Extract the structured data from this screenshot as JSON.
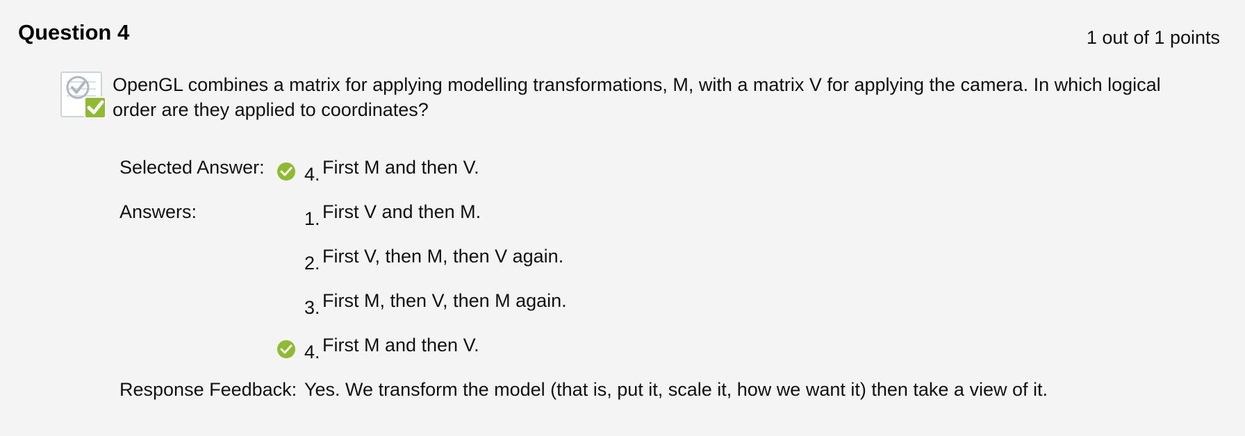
{
  "question": {
    "title": "Question 4",
    "points": "1 out of 1 points",
    "text": "OpenGL combines a matrix for applying modelling transformations, M, with a matrix V for applying the camera. In which logical order are they applied to coordinates?",
    "status_icon": "correct-question-icon"
  },
  "labels": {
    "selected_answer": "Selected Answer:",
    "answers": "Answers:",
    "response_feedback": "Response Feedback:"
  },
  "selected_answer": {
    "number": "4.",
    "text": "First M and then V.",
    "correct": true
  },
  "answers": [
    {
      "number": "1.",
      "text": "First V and then M.",
      "correct": false
    },
    {
      "number": "2.",
      "text": "First V, then M, then V again.",
      "correct": false
    },
    {
      "number": "3.",
      "text": "First M, then V, then M again.",
      "correct": false
    },
    {
      "number": "4.",
      "text": "First M and then V.",
      "correct": true
    }
  ],
  "feedback": "Yes. We transform the model (that is, put it, scale it, how we want it) then take a view of it.",
  "colors": {
    "background": "#f4f4f4",
    "correct_green": "#8fbb2f",
    "icon_blue": "#dbe9f4"
  }
}
